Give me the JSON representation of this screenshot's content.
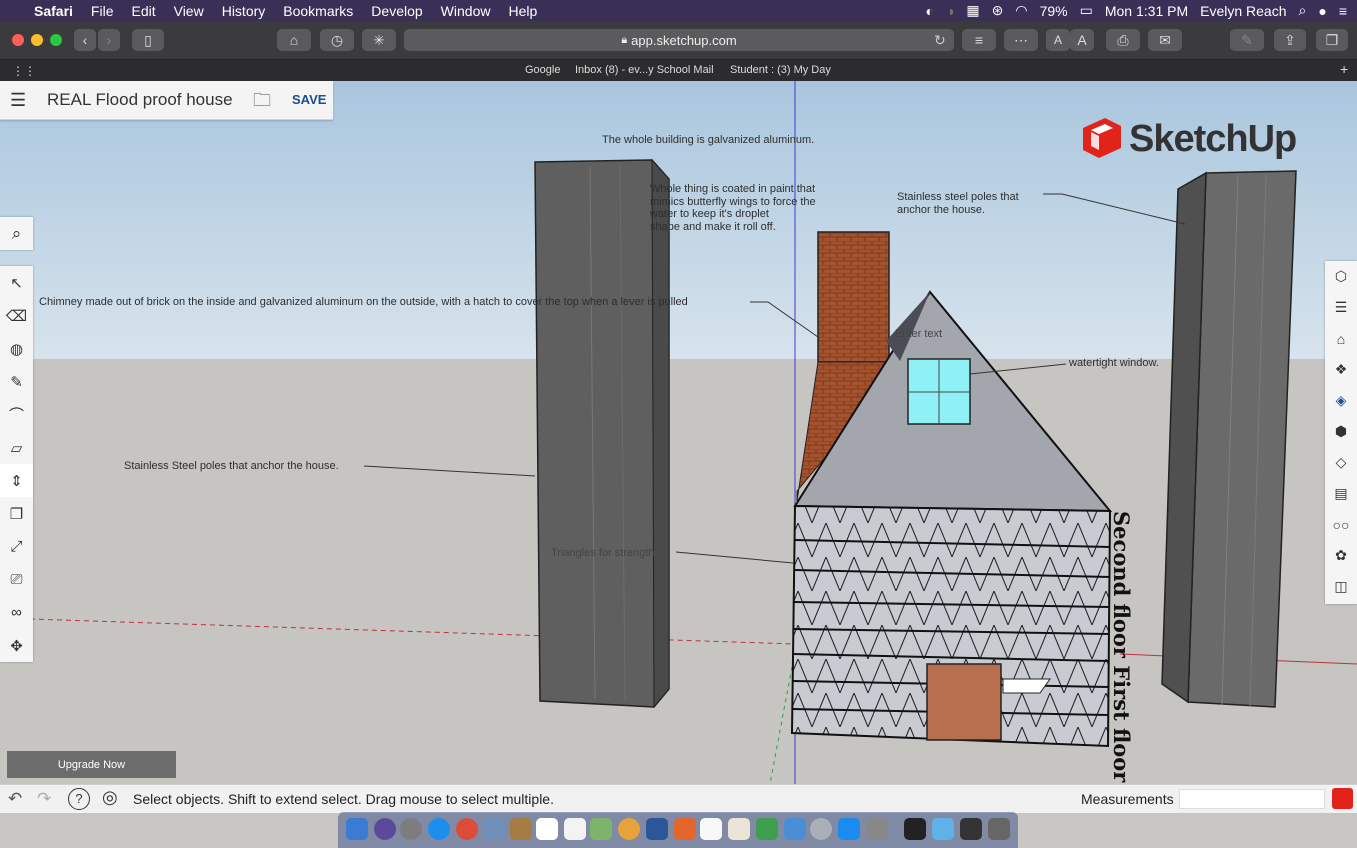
{
  "menubar": {
    "app": "Safari",
    "items": [
      "File",
      "Edit",
      "View",
      "History",
      "Bookmarks",
      "Develop",
      "Window",
      "Help"
    ],
    "battery": "79%",
    "clock": "Mon 1:31 PM",
    "user": "Evelyn Reach"
  },
  "browser": {
    "url": "app.sketchup.com",
    "favorites": [
      "Google",
      "Inbox (8) - ev...y School Mail",
      "Student : (3) My Day"
    ]
  },
  "header": {
    "model_title": "REAL Flood proof house",
    "save_label": "SAVE"
  },
  "logo_text": "SketchUp",
  "annotations": {
    "galvanized": "The whole building is galvanized aluminum.",
    "butterfly_1": "Whole thing is coated in paint that",
    "butterfly_2": "mimics butterfly wings to force the",
    "butterfly_3": "water to keep it's droplet",
    "butterfly_4": "shape and make it roll off.",
    "poles_right_1": "Stainless steel poles that",
    "poles_right_2": "anchor the house.",
    "chimney": "Chimney made out of brick on the inside and galvanized aluminum on the outside, with a hatch to cover the top when a lever is pulled",
    "enter_text": "Enter text",
    "window": "watertight window.",
    "poles_left": "Stainless Steel poles that anchor the house.",
    "triangles": "Triangles for strength",
    "floor_labels": "Second floor First floor"
  },
  "left_toolbar": [
    "search-icon",
    "select-icon",
    "eraser-icon",
    "paint-bucket-icon",
    "pencil-icon",
    "arc-icon",
    "rectangle-icon",
    "push-pull-icon",
    "move-icon",
    "scale-icon",
    "text-icon",
    "footprints-icon",
    "orbit-icon"
  ],
  "right_toolbar": [
    "entity-info-icon",
    "layers-icon",
    "instructor-icon",
    "components-icon",
    "materials-icon",
    "solid-icon",
    "tags-icon",
    "scenes-icon",
    "display-icon",
    "styles-icon",
    "outliner-icon"
  ],
  "upgrade_label": "Upgrade Now",
  "status": {
    "message": "Select objects. Shift to extend select. Drag mouse to select multiple.",
    "measurements_label": "Measurements",
    "measurements_value": ""
  },
  "colors": {
    "menubar": "#3a2f57",
    "accent": "#1b4e93",
    "brand_red": "#e2231a",
    "window_glass": "#8ff1f5",
    "brick": "#a4532e",
    "door": "#b86f4e"
  }
}
